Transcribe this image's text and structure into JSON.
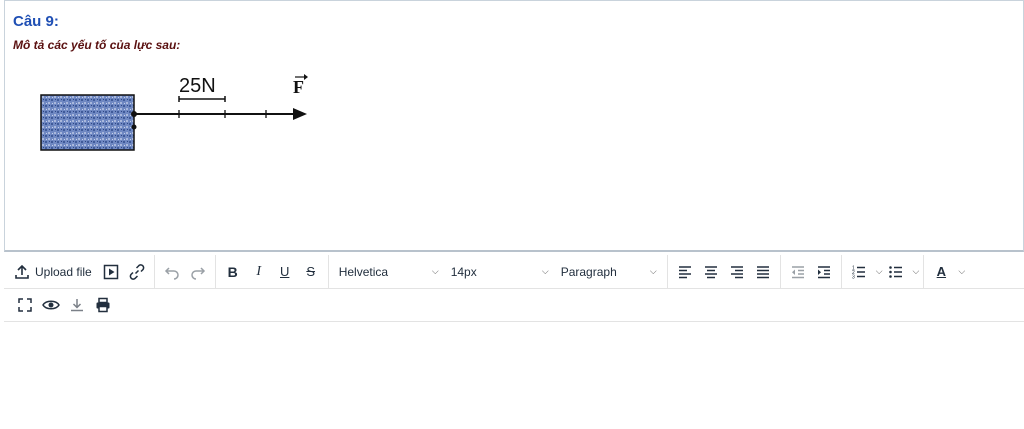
{
  "question": {
    "title": "Câu 9:",
    "text": "Mô tả các yếu tố của lực sau:",
    "figure": {
      "scale_label": "25N",
      "vector_label": "F"
    }
  },
  "toolbar": {
    "upload_label": "Upload file",
    "font_family": "Helvetica",
    "font_size": "14px",
    "block_format": "Paragraph",
    "bold_label": "B",
    "italic_label": "I",
    "underline_label": "U",
    "strike_label": "S",
    "text_color_label": "A"
  },
  "colors": {
    "title": "#1f4fb4",
    "question_text": "#5a1010",
    "toolbar_icon": "#222f3e",
    "box_fill": "#5b78b6"
  }
}
